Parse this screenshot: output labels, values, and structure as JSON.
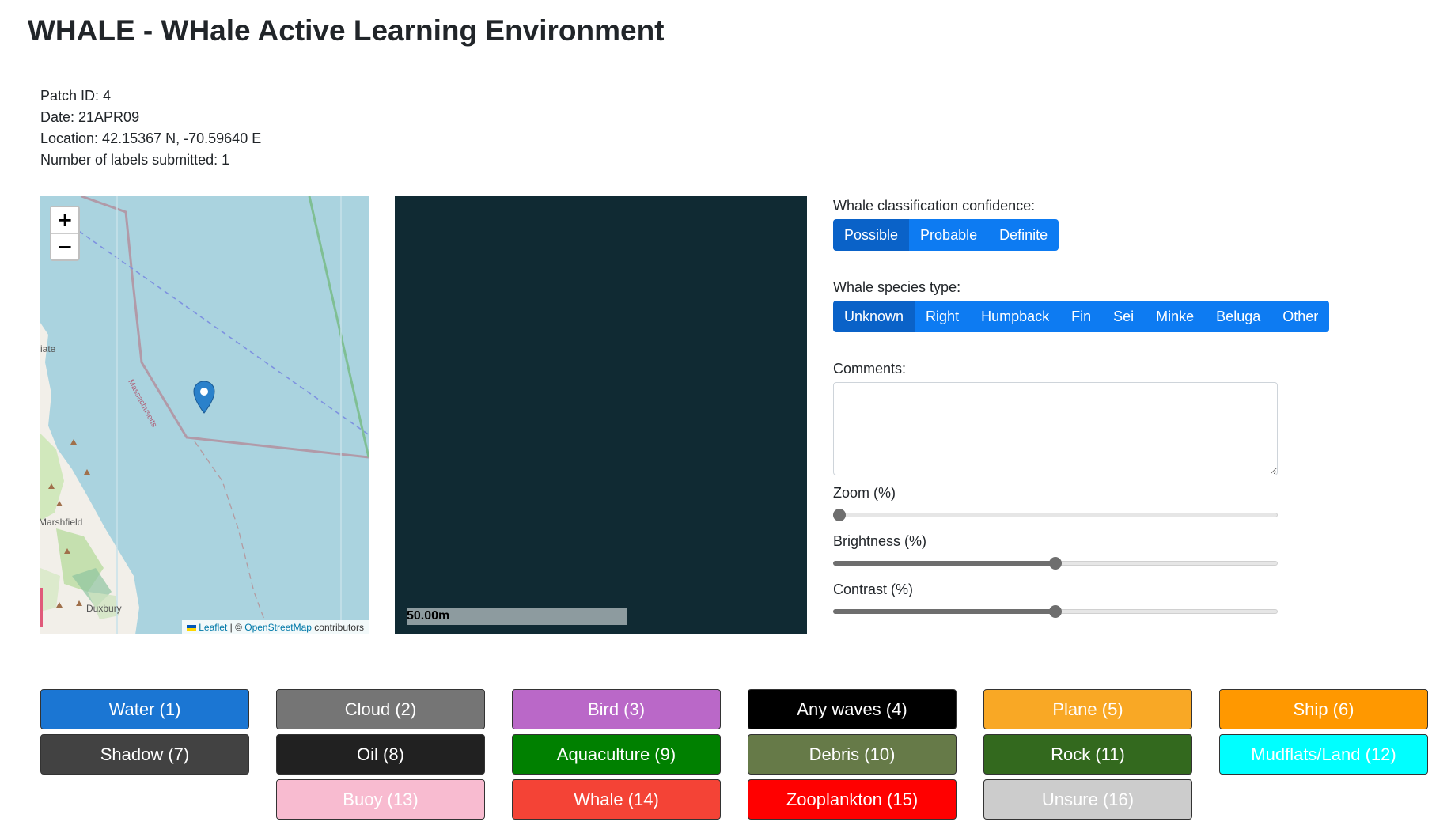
{
  "page": {
    "title": "WHALE - WHale Active Learning Environment"
  },
  "meta": {
    "patch_id": "Patch ID: 4",
    "date": "Date: 21APR09",
    "location": "Location: 42.15367 N, -70.59640 E",
    "labels_submitted": "Number of labels submitted: 1"
  },
  "map": {
    "zoom_in": "+",
    "zoom_out": "−",
    "places": {
      "truncated": "iate",
      "marshfield": "Marshfield",
      "duxbury": "Duxbury",
      "state_line": "Massachusetts"
    },
    "attribution": {
      "leaflet": "Leaflet",
      "sep": " | © ",
      "osm": "OpenStreetMap",
      "suffix": " contributors"
    }
  },
  "patch": {
    "scale_label": "50.00m"
  },
  "controls": {
    "confidence": {
      "label": "Whale classification confidence:",
      "options": [
        "Possible",
        "Probable",
        "Definite"
      ]
    },
    "species": {
      "label": "Whale species type:",
      "options": [
        "Unknown",
        "Right",
        "Humpback",
        "Fin",
        "Sei",
        "Minke",
        "Beluga",
        "Other"
      ]
    },
    "comments": {
      "label": "Comments:",
      "value": ""
    },
    "zoom": {
      "label": "Zoom (%)",
      "value": 0
    },
    "brightness": {
      "label": "Brightness (%)",
      "value": 50
    },
    "contrast": {
      "label": "Contrast (%)",
      "value": 50
    }
  },
  "labels": [
    {
      "text": "Water (1)",
      "bg": "#1b76d3",
      "fg": "#ffffff"
    },
    {
      "text": "Cloud (2)",
      "bg": "#757575",
      "fg": "#ffffff"
    },
    {
      "text": "Bird (3)",
      "bg": "#ba68c8",
      "fg": "#ffffff"
    },
    {
      "text": "Any waves (4)",
      "bg": "#000000",
      "fg": "#ffffff"
    },
    {
      "text": "Plane (5)",
      "bg": "#f9a825",
      "fg": "#ffffff"
    },
    {
      "text": "Ship (6)",
      "bg": "#ff9800",
      "fg": "#ffffff"
    },
    {
      "text": "Shadow (7)",
      "bg": "#424242",
      "fg": "#ffffff"
    },
    {
      "text": "Oil (8)",
      "bg": "#212121",
      "fg": "#ffffff"
    },
    {
      "text": "Aquaculture (9)",
      "bg": "#008000",
      "fg": "#ffffff"
    },
    {
      "text": "Debris (10)",
      "bg": "#667a48",
      "fg": "#ffffff"
    },
    {
      "text": "Rock (11)",
      "bg": "#33691e",
      "fg": "#ffffff"
    },
    {
      "text": "Mudflats/Land (12)",
      "bg": "#00ffff",
      "fg": "#ffffff"
    },
    {
      "text": "Buoy (13)",
      "bg": "#f8bbd0",
      "fg": "#ffffff"
    },
    {
      "text": "Whale (14)",
      "bg": "#f44336",
      "fg": "#ffffff"
    },
    {
      "text": "Zooplankton (15)",
      "bg": "#ff0000",
      "fg": "#ffffff"
    },
    {
      "text": "Unsure (16)",
      "bg": "#cccccc",
      "fg": "#ffffff"
    }
  ]
}
